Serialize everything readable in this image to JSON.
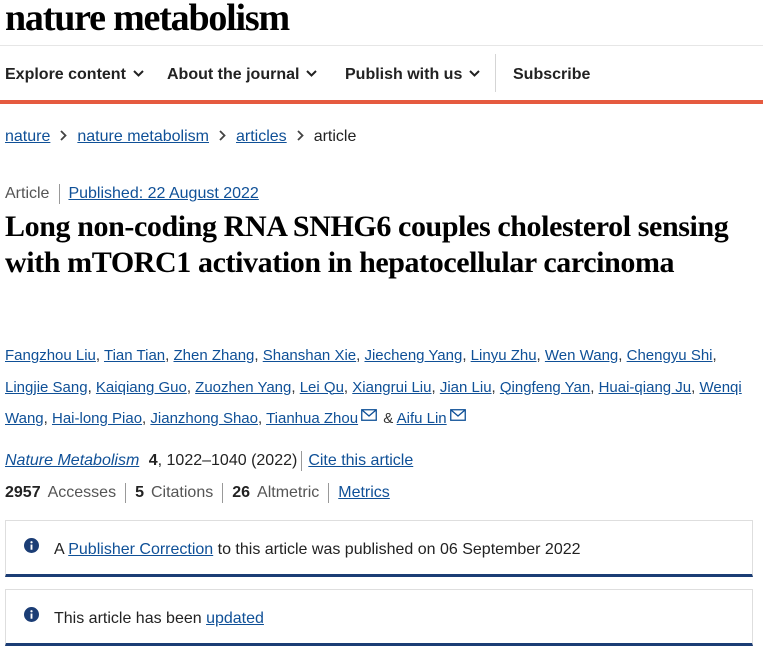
{
  "brand": "nature metabolism",
  "nav": {
    "items": [
      {
        "label": "Explore content",
        "icon": "chevron-down-icon"
      },
      {
        "label": "About the journal",
        "icon": "chevron-down-icon"
      },
      {
        "label": "Publish with us",
        "icon": "chevron-down-icon"
      },
      {
        "label": "Subscribe"
      }
    ],
    "accent_color": "#e55a3f"
  },
  "breadcrumb": [
    "nature",
    "nature metabolism",
    "articles",
    "article"
  ],
  "article": {
    "type": "Article",
    "published": "Published: 22 August 2022",
    "title": "Long non-coding RNA SNHG6 couples cholesterol sensing with mTORC1 activation in hepatocellular carcinoma",
    "authors": [
      "Fangzhou Liu",
      "Tian Tian",
      "Zhen Zhang",
      "Shanshan Xie",
      "Jiecheng Yang",
      "Linyu Zhu",
      "Wen Wang",
      "Chengyu Shi",
      "Lingjie Sang",
      "Kaiqiang Guo",
      "Zuozhen Yang",
      "Lei Qu",
      "Xiangrui Liu",
      "Jian Liu",
      "Qingfeng Yan",
      "Huai-qiang Ju",
      "Wenqi Wang",
      "Hai-long Piao",
      "Jianzhong Shao",
      "Tianhua Zhou",
      "Aifu Lin"
    ],
    "and": "&",
    "citation": {
      "journal": "Nature Metabolism",
      "volume": "4",
      "pages": ", 1022–1040 (2022)",
      "cite_link": "Cite this article"
    },
    "metrics": {
      "accesses_value": "2957",
      "accesses_label": "Accesses",
      "citations_value": "5",
      "citations_label": "Citations",
      "altmetric_value": "26",
      "altmetric_label": "Altmetric",
      "metrics_link": "Metrics"
    }
  },
  "notices": [
    {
      "prefix": "A ",
      "link": "Publisher Correction",
      "suffix": " to this article was published on 06 September 2022",
      "icon": "info-icon"
    },
    {
      "prefix": "This article has been ",
      "link": "updated",
      "suffix": "",
      "icon": "info-icon"
    }
  ]
}
